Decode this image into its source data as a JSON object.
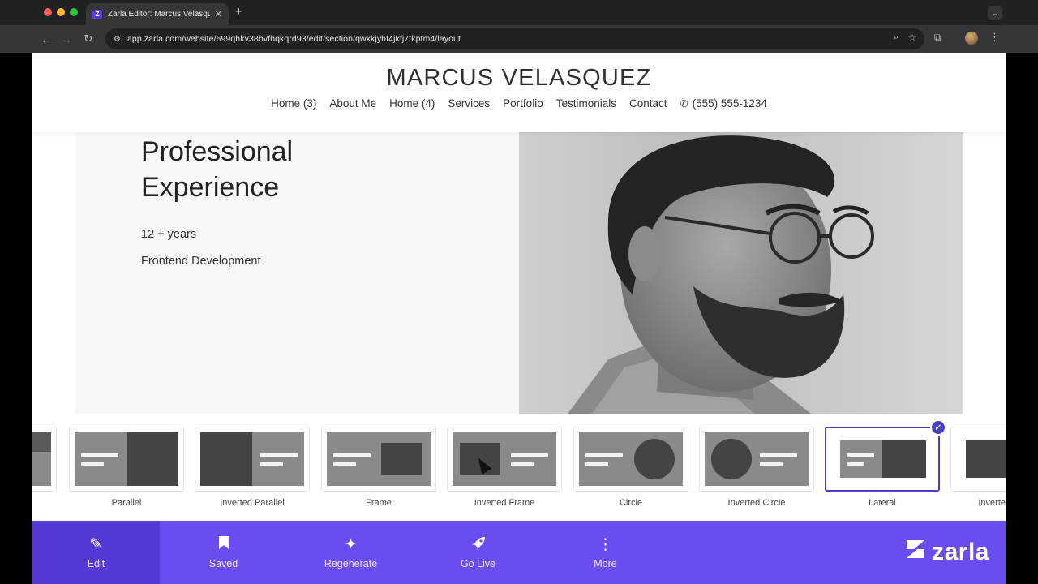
{
  "browser": {
    "tab_title": "Zarla Editor: Marcus Velasquez",
    "url": "app.zarla.com/website/699qhkv38bvfbqkqrd93/edit/section/qwkkjyhf4jkfj7tkptm4/layout"
  },
  "site": {
    "name": "MARCUS VELASQUEZ",
    "nav": [
      "Home (3)",
      "About Me",
      "Home (4)",
      "Services",
      "Portfolio",
      "Testimonials",
      "Contact"
    ],
    "phone": "(555) 555-1234"
  },
  "section": {
    "heading": "Professional Experience",
    "years": "12 + years",
    "role": "Frontend Development"
  },
  "layouts": [
    {
      "label": "Parallel",
      "selected": false
    },
    {
      "label": "Inverted Parallel",
      "selected": false
    },
    {
      "label": "Frame",
      "selected": false
    },
    {
      "label": "Inverted Frame",
      "selected": false
    },
    {
      "label": "Circle",
      "selected": false
    },
    {
      "label": "Inverted Circle",
      "selected": false
    },
    {
      "label": "Lateral",
      "selected": true
    },
    {
      "label": "Inverte",
      "selected": false
    }
  ],
  "bottom_bar": {
    "items": [
      {
        "label": "Edit",
        "icon": "pencil-icon"
      },
      {
        "label": "Saved",
        "icon": "bookmark-icon"
      },
      {
        "label": "Regenerate",
        "icon": "sparkle-icon"
      },
      {
        "label": "Go Live",
        "icon": "rocket-icon"
      },
      {
        "label": "More",
        "icon": "more-vertical-icon"
      }
    ],
    "brand": "zarla"
  },
  "colors": {
    "accent": "#6a4cf0",
    "accent_active": "#5638d6",
    "selected_border": "#4b3fc4"
  }
}
